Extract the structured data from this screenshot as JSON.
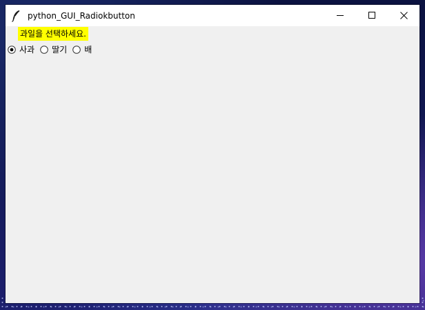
{
  "window": {
    "title": "python_GUI_Radiokbutton",
    "icon": "feather-icon",
    "controls": [
      "minimize-icon",
      "maximize-icon",
      "close-icon"
    ]
  },
  "main": {
    "prompt": "과일을 선택하세요.",
    "prompt_background": "#ffff00",
    "radios": [
      {
        "label": "사과",
        "selected": true
      },
      {
        "label": "딸기",
        "selected": false
      },
      {
        "label": "배",
        "selected": false
      }
    ]
  }
}
